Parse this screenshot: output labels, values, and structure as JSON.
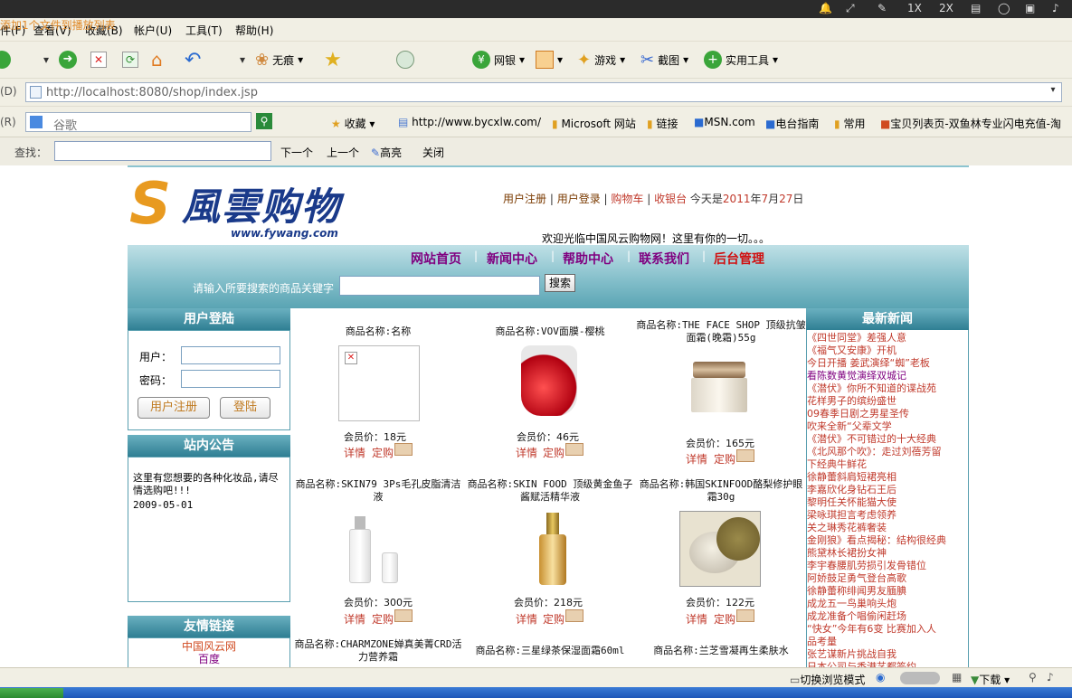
{
  "browser": {
    "top_icons": [
      "1X",
      "2X"
    ],
    "overlay_text": "添加1个文件到播放列表",
    "menu": [
      "件(F)",
      "查看(V)",
      "收藏(B)",
      "帐户(U)",
      "工具(T)",
      "帮助(H)"
    ],
    "toolbar": {
      "wuhen": "无痕",
      "wangyin": "网银",
      "youxi": "游戏",
      "jietu": "截图",
      "shiyong": "实用工具"
    },
    "addr_label": "(D)",
    "url": "http://localhost:8080/shop/index.jsp",
    "search_label": "(R)",
    "search_placeholder": "谷歌",
    "links": {
      "favorites": "收藏",
      "l1": "http://www.bycxlw.com/",
      "l2": "Microsoft 网站",
      "l3": "链接",
      "l4": "MSN.com",
      "l5": "电台指南",
      "l6": "常用",
      "l7": "宝贝列表页-双鱼林专业闪电充值-淘"
    },
    "find": {
      "label": "查找：",
      "next": "下一个",
      "prev": "上一个",
      "highlight": "高亮",
      "close": "关闭"
    },
    "status": {
      "mode": "切换浏览模式",
      "download": "下载"
    }
  },
  "site": {
    "logo_text": "風雲购物",
    "logo_url": "www.fywang.com",
    "hdr": {
      "register": "用户注册",
      "login": "用户登录",
      "cart": "购物车",
      "checkout": "收银台",
      "today_prefix": "今天是",
      "year": "2011",
      "y": "年",
      "month": "7",
      "m": "月",
      "day": "27",
      "d": "日"
    },
    "welcome": "欢迎光临中国风云购物网！这里有你的一切。。。",
    "nav": [
      "网站首页",
      "新闻中心",
      "帮助中心",
      "联系我们",
      "后台管理"
    ],
    "search_prompt": "请输入所要搜索的商品关键字",
    "search_btn": "搜索"
  },
  "login_panel": {
    "title": "用户登陆",
    "user_label": "用户：",
    "pass_label": "密码：",
    "register_btn": "用户注册",
    "login_btn": "登陆"
  },
  "notice_panel": {
    "title": "站内公告",
    "text": "这里有您想要的各种化妆品,请尽情选购吧!!!",
    "date": "2009-05-01"
  },
  "links_panel": {
    "title": "友情链接",
    "items": [
      "中国风云网",
      "百度"
    ]
  },
  "products": [
    {
      "name": "商品名称:名称",
      "price": "会员价：18元",
      "detail": "详情",
      "order": "定购",
      "img": "broken"
    },
    {
      "name": "商品名称:VOV面膜-樱桃",
      "price": "会员价：46元",
      "detail": "详情",
      "order": "定购",
      "img": "cherry"
    },
    {
      "name": "商品名称:THE FACE SHOP 顶级抗皱面霜(晚霜)55g",
      "price": "会员价：165元",
      "detail": "详情",
      "order": "定购",
      "img": "jar"
    },
    {
      "name": "商品名称:SKIN79 3Ps毛孔皮脂清洁液",
      "price": "会员价：300元",
      "detail": "详情",
      "order": "定购",
      "img": "bottle"
    },
    {
      "name": "商品名称:SKIN FOOD 顶级黄金鱼子酱赋活精华液",
      "price": "会员价：218元",
      "detail": "详情",
      "order": "定购",
      "img": "gold"
    },
    {
      "name": "商品名称:韩国SKINFOOD酪梨修护眼霜30g",
      "price": "会员价：122元",
      "detail": "详情",
      "order": "定购",
      "img": "eyecream"
    },
    {
      "name": "商品名称:CHARMZONE婵真美菁CRD活力营养霜",
      "img": "none"
    },
    {
      "name": "商品名称:三星绿茶保湿面霜60ml",
      "img": "none"
    },
    {
      "name": "商品名称:兰芝雪凝再生柔肤水",
      "img": "none"
    }
  ],
  "news_panel": {
    "title": "最新新闻",
    "items": [
      "《四世同堂》差强人意",
      "《福气又安康》开机",
      "今日开播  姜武演绎“蜘”老板",
      "看陈数黄觉演绎双城记",
      "《潜伏》你所不知道的谍战苑",
      "花样男子的缤纷盛世",
      "09春季日剧之男星圣传",
      "吹来全新“父辈文学",
      "《潜伏》不可错过的十大经典",
      "《北风那个吹》：走过刘蓓芳留",
      "下经典牛鲜花",
      "徐静蕾斜肩短裙亮相",
      "李嘉欣化身钻石王后",
      "黎明任关怀能猫大使",
      "梁咏琪担言考虑领养",
      "关之琳秀花裤奢装",
      "金刚狼》看点揭秘：结构很经典",
      "熊黛林长裙扮女神",
      "李宇春腰肌劳损引发骨错位",
      "阿娇鼓足勇气登台高歌",
      "徐静蕾称绯闻男友腼腆",
      "成龙五一鸟巢响头炮",
      "成龙准备个唱偷闲赶场",
      "“快女”今年有6变 比赛加入人",
      "品考量",
      "张艺谋新片挑战自我",
      "日本公司与香港艺都签约"
    ]
  }
}
